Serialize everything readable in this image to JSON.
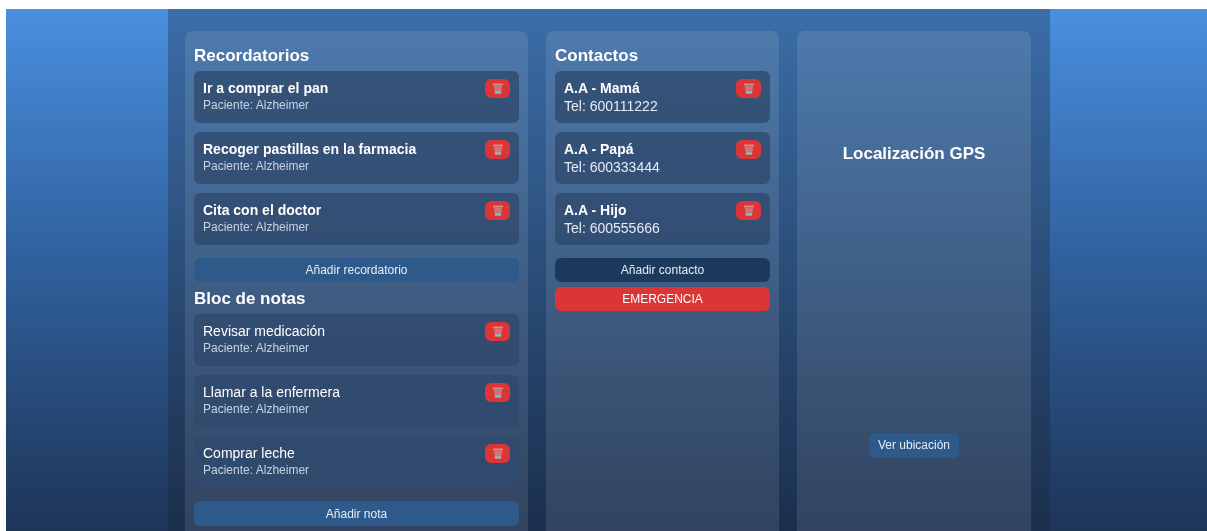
{
  "reminders": {
    "title": "Recordatorios",
    "items": [
      {
        "title": "Ir a comprar el pan",
        "patient": "Paciente: Alzheimer"
      },
      {
        "title": "Recoger pastillas en la farmacia",
        "patient": "Paciente: Alzheimer"
      },
      {
        "title": "Cita con el doctor",
        "patient": "Paciente: Alzheimer"
      }
    ],
    "add_button": "Añadir recordatorio"
  },
  "notes": {
    "title": "Bloc de notas",
    "items": [
      {
        "title": "Revisar medicación",
        "patient": "Paciente: Alzheimer"
      },
      {
        "title": "Llamar a la enfermera",
        "patient": "Paciente: Alzheimer"
      },
      {
        "title": "Comprar leche",
        "patient": "Paciente: Alzheimer"
      }
    ],
    "add_button": "Añadir nota"
  },
  "contacts": {
    "title": "Contactos",
    "items": [
      {
        "name": "A.A - Mamá",
        "phone": "Tel: 600111222"
      },
      {
        "name": "A.A - Papá",
        "phone": "Tel: 600333444"
      },
      {
        "name": "A.A - Hijo",
        "phone": "Tel: 600555666"
      }
    ],
    "add_button": "Añadir contacto",
    "emergency_button": "EMERGENCIA"
  },
  "gps": {
    "title": "Localización GPS",
    "button": "Ver ubicación"
  }
}
